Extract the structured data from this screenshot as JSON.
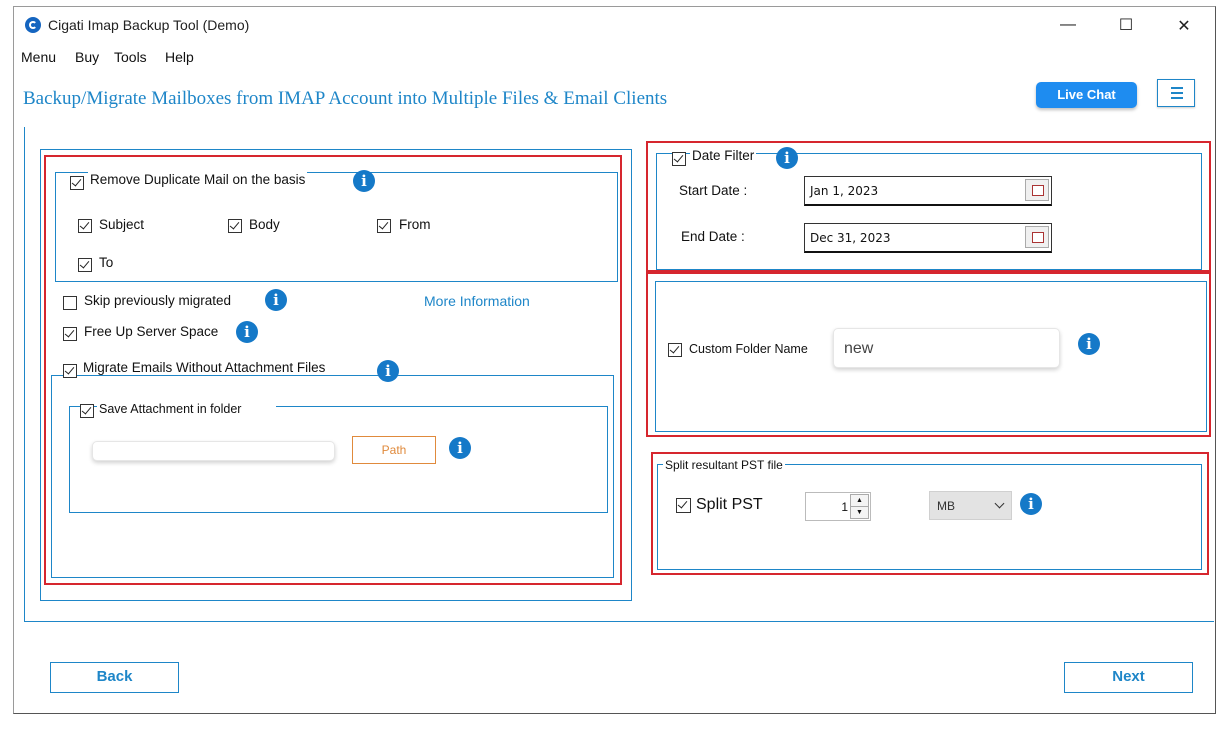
{
  "window": {
    "title": "Cigati Imap Backup Tool (Demo)",
    "controls": {
      "minimize": "—",
      "maximize": "☐",
      "close": "✕"
    }
  },
  "menu": [
    "Menu",
    "Buy",
    "Tools",
    "Help"
  ],
  "header": {
    "title": "Backup/Migrate Mailboxes from IMAP Account into Multiple Files & Email Clients",
    "live_chat": "Live Chat"
  },
  "left": {
    "remove_duplicate": {
      "label": "Remove Duplicate Mail on the basis",
      "checked": true
    },
    "dup_options": [
      {
        "label": "Subject",
        "checked": true
      },
      {
        "label": "Body",
        "checked": true
      },
      {
        "label": "From",
        "checked": true
      },
      {
        "label": "To",
        "checked": true
      }
    ],
    "skip_previously": {
      "label": "Skip previously migrated",
      "checked": false
    },
    "more_information": "More Information",
    "free_up": {
      "label": "Free Up Server Space",
      "checked": true
    },
    "migrate_without_attach": {
      "label": "Migrate Emails Without Attachment Files",
      "checked": true
    },
    "save_attachment": {
      "label": "Save Attachment in folder",
      "checked": true
    },
    "path_value": "",
    "path_button": "Path"
  },
  "right": {
    "date_filter": {
      "label": "Date Filter",
      "checked": true
    },
    "start_date_label": "Start Date :",
    "start_date": "Jan 1, 2023",
    "end_date_label": "End Date :",
    "end_date": "Dec 31, 2023",
    "custom_folder": {
      "label": "Custom Folder Name",
      "checked": true,
      "value": "new"
    },
    "split_group_title": "Split resultant PST file",
    "split_pst": {
      "label": "Split PST",
      "checked": true,
      "value": "1"
    },
    "size_unit": "MB"
  },
  "footer": {
    "back": "Back",
    "next": "Next"
  },
  "info_icon_glyph": "i",
  "colors": {
    "accent": "#1e86c8",
    "highlight_red": "#d6262e",
    "live_chat_bg": "#1e8cf0",
    "path_orange": "#e08a3c"
  }
}
